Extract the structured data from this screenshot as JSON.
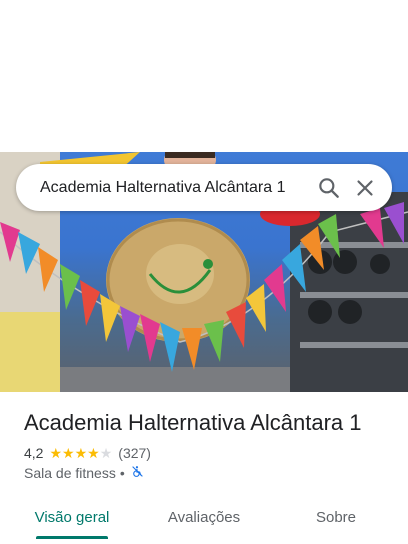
{
  "search": {
    "query": "Academia Halternativa Alcântara 1",
    "search_icon": "search-icon",
    "close_icon": "close-icon"
  },
  "place": {
    "name": "Academia Halternativa Alcântara 1",
    "rating": "4,2",
    "rating_value": 4.2,
    "review_count": "(327)",
    "category": "Sala de fitness",
    "separator": "•",
    "accessibility_icon": "wheelchair-not-accessible-icon"
  },
  "tabs": [
    {
      "label": "Visão geral",
      "active": true
    },
    {
      "label": "Avaliações",
      "active": false
    },
    {
      "label": "Sobre",
      "active": false
    }
  ],
  "colors": {
    "accent": "#00796b",
    "star": "#fbbc04",
    "star_empty": "#dadce0",
    "accessibility_blue": "#1a73e8"
  }
}
